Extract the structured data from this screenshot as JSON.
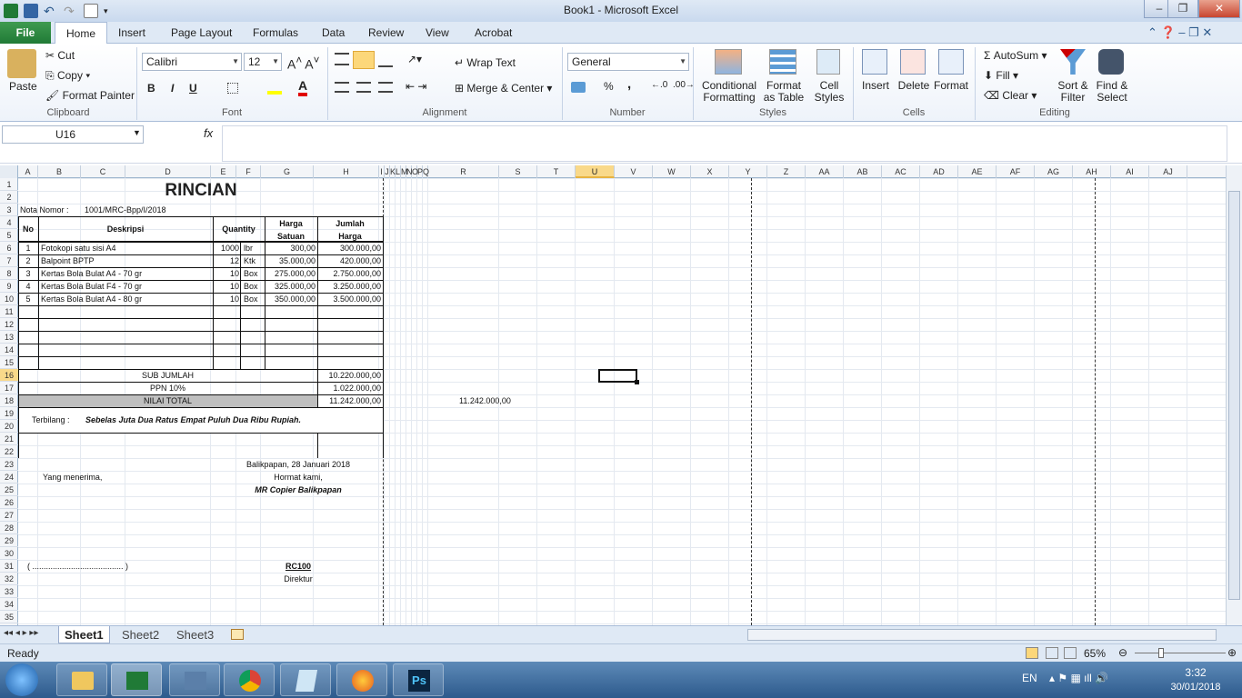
{
  "window": {
    "title": "Book1  -  Microsoft Excel"
  },
  "tabs": [
    "File",
    "Home",
    "Insert",
    "Page Layout",
    "Formulas",
    "Data",
    "Review",
    "View",
    "Acrobat"
  ],
  "active_tab": "Home",
  "clipboard": {
    "paste": "Paste",
    "cut": "Cut",
    "copy": "Copy",
    "format_painter": "Format Painter",
    "label": "Clipboard"
  },
  "font": {
    "name": "Calibri",
    "size": "12",
    "bold": "B",
    "italic": "I",
    "underline": "U",
    "label": "Font"
  },
  "alignment": {
    "wrap_text": "Wrap Text",
    "merge_center": "Merge & Center",
    "label": "Alignment"
  },
  "number": {
    "format": "General",
    "percent": "%",
    "comma": ",",
    "label": "Number"
  },
  "styles": {
    "conditional": "Conditional\nFormatting",
    "format_table": "Format\nas Table",
    "cell_styles": "Cell\nStyles",
    "label": "Styles"
  },
  "cells": {
    "insert": "Insert",
    "delete": "Delete",
    "format": "Format",
    "label": "Cells"
  },
  "editing": {
    "autosum": "AutoSum",
    "fill": "Fill",
    "clear": "Clear",
    "sort_filter": "Sort &\nFilter",
    "find_select": "Find &\nSelect",
    "label": "Editing"
  },
  "formula_bar": {
    "name_box": "U16",
    "fx": "fx",
    "content": ""
  },
  "columns": [
    "A",
    "B",
    "C",
    "D",
    "E",
    "F",
    "G",
    "H",
    "I",
    "J",
    "K",
    "L",
    "M",
    "N",
    "O",
    "P",
    "Q",
    "R",
    "S",
    "T",
    "U",
    "V",
    "W",
    "X",
    "Y",
    "Z",
    "AA",
    "AB",
    "AC",
    "AD",
    "AE",
    "AF",
    "AG",
    "AH",
    "AI",
    "AJ"
  ],
  "selected_column": "U",
  "selected_row": "16",
  "sheet": {
    "title": "RINCIAN",
    "nota_label": "Nota Nomor :",
    "nota_value": "1001/MRC-Bpp/I/2018",
    "headers": {
      "no": "No",
      "deskripsi": "Deskripsi",
      "quantity": "Quantity",
      "harga": "Harga",
      "satuan": "Satuan",
      "jumlah": "Jumlah",
      "jharga": "Harga"
    },
    "items": [
      {
        "no": "1",
        "desc": "Fotokopi satu sisi A4",
        "qty": "1000",
        "unit": "lbr",
        "price": "300,00",
        "total": "300.000,00"
      },
      {
        "no": "2",
        "desc": "Balpoint BPTP",
        "qty": "12",
        "unit": "Ktk",
        "price": "35.000,00",
        "total": "420.000,00"
      },
      {
        "no": "3",
        "desc": "Kertas Bola Bulat A4 - 70 gr",
        "qty": "10",
        "unit": "Box",
        "price": "275.000,00",
        "total": "2.750.000,00"
      },
      {
        "no": "4",
        "desc": "Kertas Bola Bulat F4 - 70 gr",
        "qty": "10",
        "unit": "Box",
        "price": "325.000,00",
        "total": "3.250.000,00"
      },
      {
        "no": "5",
        "desc": "Kertas Bola Bulat A4 - 80 gr",
        "qty": "10",
        "unit": "Box",
        "price": "350.000,00",
        "total": "3.500.000,00"
      }
    ],
    "sub_jumlah_label": "SUB JUMLAH",
    "sub_jumlah": "10.220.000,00",
    "ppn_label": "PPN 10%",
    "ppn": "1.022.000,00",
    "nilai_total_label": "NILAI TOTAL",
    "nilai_total": "11.242.000,00",
    "r18_value": "11.242.000,00",
    "terbilang_label": "Terbilang :",
    "terbilang": "Sebelas Juta Dua Ratus Empat Puluh Dua Ribu Rupiah.",
    "place_date": "Balikpapan, 28 Januari 2018",
    "receiver": "Yang menerima,",
    "hormat": "Hormat kami,",
    "company": "MR Copier Balikpapan",
    "sign_blank": "( ........................................ )",
    "signer": "RC100",
    "position": "Direktur"
  },
  "sheets": [
    "Sheet1",
    "Sheet2",
    "Sheet3"
  ],
  "active_sheet": "Sheet1",
  "status": {
    "ready": "Ready",
    "zoom": "65%"
  },
  "taskbar": {
    "lang": "EN",
    "time": "3:32",
    "date": "30/01/2018"
  },
  "colors": {
    "excel_green": "#207a36",
    "selection": "#f9d98a",
    "total_fill": "#bfbfbf"
  }
}
